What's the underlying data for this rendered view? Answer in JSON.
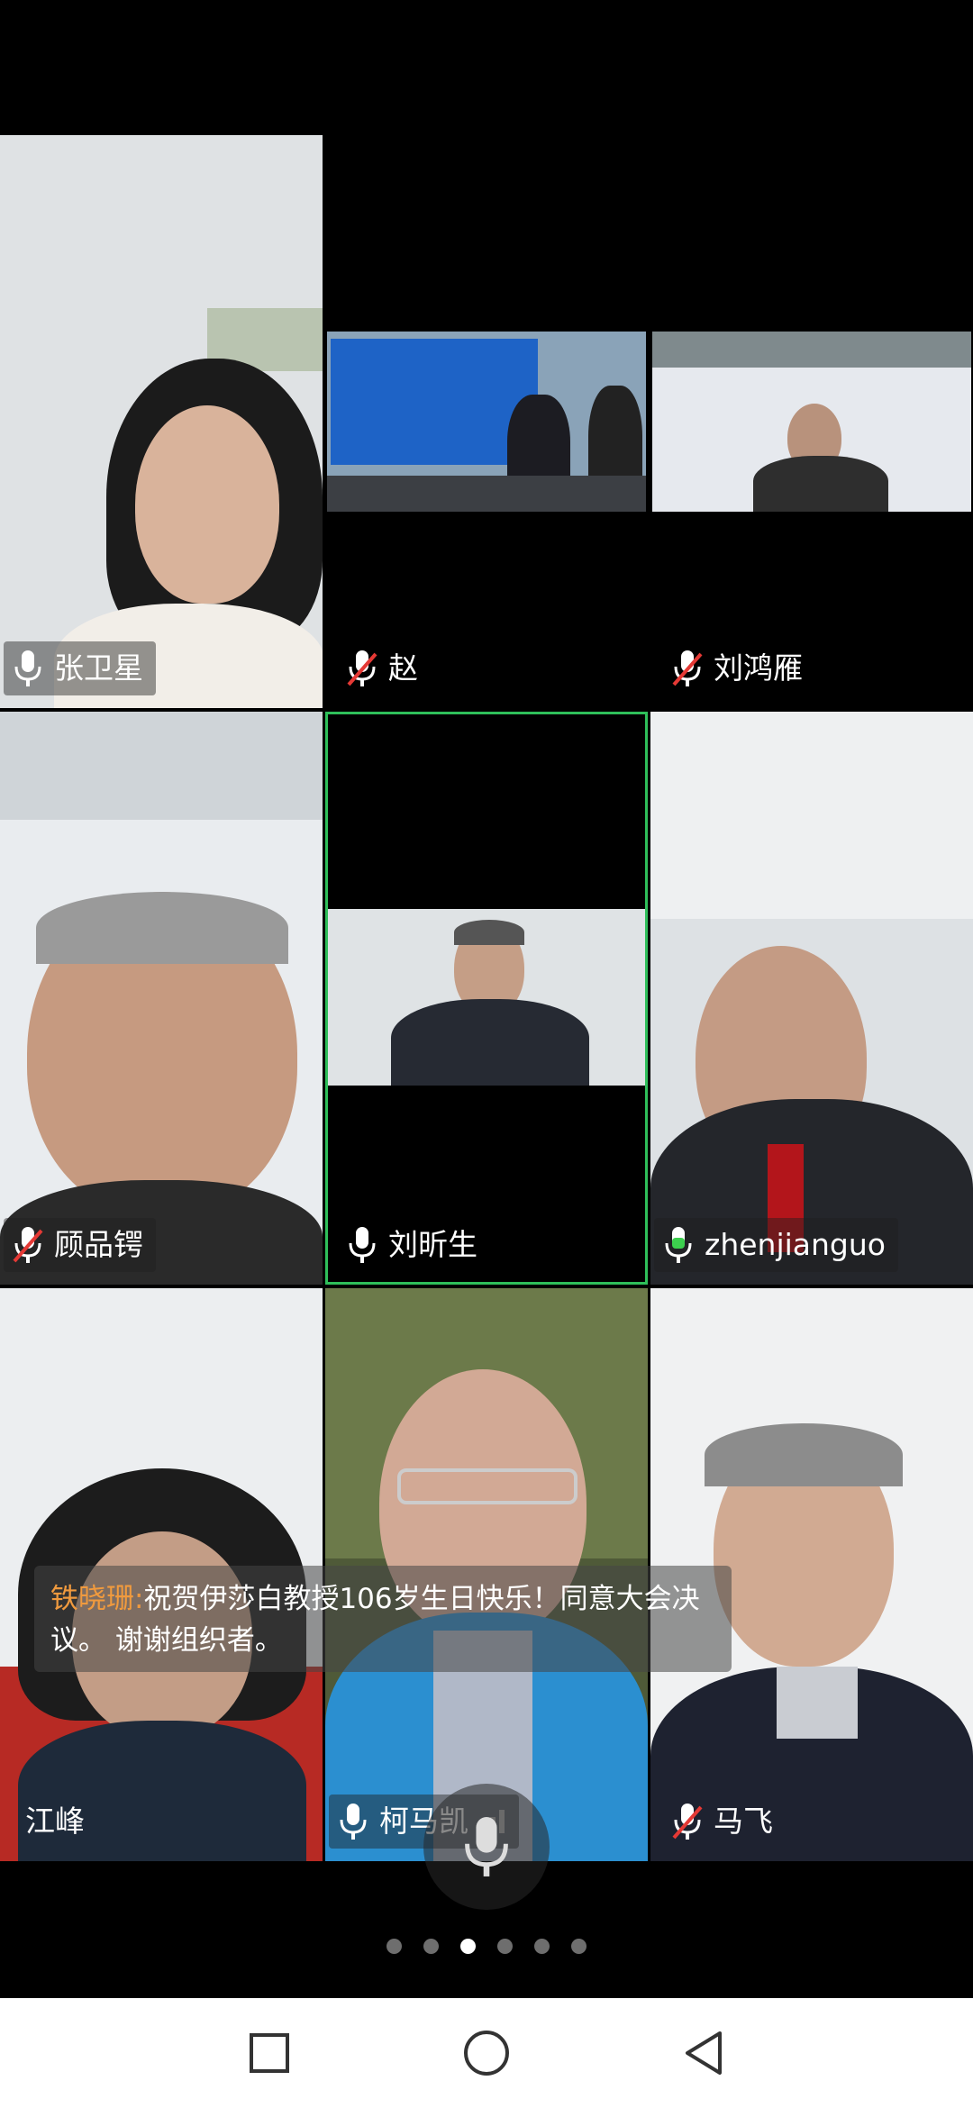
{
  "participants": [
    {
      "name": "张卫星",
      "muted": false
    },
    {
      "name": "赵",
      "muted": true
    },
    {
      "name": "刘鸿雁",
      "muted": true
    },
    {
      "name": "顾品锷",
      "muted": true
    },
    {
      "name": "刘昕生",
      "muted": false,
      "active_speaker": true
    },
    {
      "name": "zhenjianguo",
      "muted": false,
      "speaking": true
    },
    {
      "name": "江峰",
      "no_mic_icon": true
    },
    {
      "name": "柯马凯",
      "muted": false
    },
    {
      "name": "马飞",
      "muted": true
    }
  ],
  "chat_message": {
    "sender": "铁晓珊:",
    "text": "祝贺伊莎白教授106岁生日快乐！同意大会决议。 谢谢组织者。"
  },
  "page_indicator": {
    "total": 6,
    "current": 3
  },
  "colors": {
    "active_border": "#2fbf5a",
    "muted_slash": "#e53935",
    "speaking_green": "#3ccf4e",
    "sender_orange": "#f09a3e"
  },
  "icons": {
    "mic": "microphone-icon",
    "muted": "microphone-muted-icon",
    "nav": [
      "square-recents-icon",
      "circle-home-icon",
      "triangle-back-icon"
    ]
  }
}
